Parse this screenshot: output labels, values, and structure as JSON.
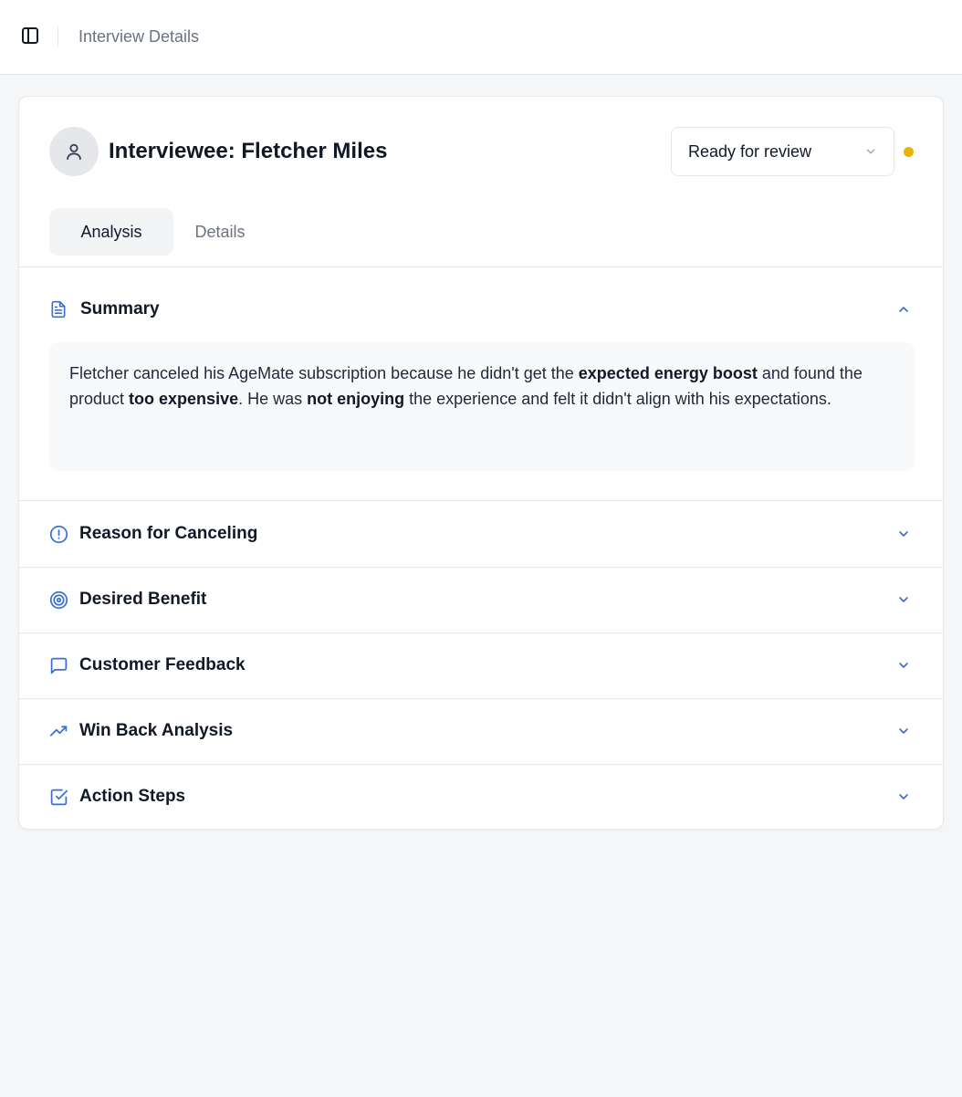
{
  "header": {
    "breadcrumb": "Interview Details"
  },
  "interviewee": {
    "title": "Interviewee: Fletcher Miles"
  },
  "status": {
    "value": "Ready for review",
    "dot_color": "#eab308"
  },
  "tabs": [
    {
      "label": "Analysis",
      "active": true
    },
    {
      "label": "Details",
      "active": false
    }
  ],
  "summary": {
    "title": "Summary",
    "expanded": true,
    "text_parts": [
      {
        "t": "Fletcher canceled his AgeMate subscription because he didn't get the ",
        "b": false
      },
      {
        "t": "expected energy boost",
        "b": true
      },
      {
        "t": " and found the product ",
        "b": false
      },
      {
        "t": "too expensive",
        "b": true
      },
      {
        "t": ". He was ",
        "b": false
      },
      {
        "t": "not enjoying",
        "b": true
      },
      {
        "t": " the experience and felt it didn't align with his expectations.",
        "b": false
      }
    ]
  },
  "sections": [
    {
      "title": "Reason for Canceling",
      "icon": "alert-circle-icon"
    },
    {
      "title": "Desired Benefit",
      "icon": "target-icon"
    },
    {
      "title": "Customer Feedback",
      "icon": "message-square-icon"
    },
    {
      "title": "Win Back Analysis",
      "icon": "trending-up-icon"
    },
    {
      "title": "Action Steps",
      "icon": "check-square-icon"
    }
  ],
  "colors": {
    "accent": "#3b6fd6",
    "muted": "#6b7280"
  }
}
